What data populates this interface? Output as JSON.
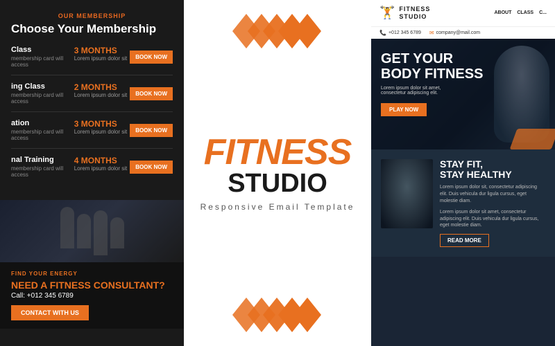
{
  "left": {
    "membership": {
      "our_membership": "OUR MEMBERSHIP",
      "title": "Choose Your Membership",
      "items": [
        {
          "name": "Class",
          "desc": "membership card will access",
          "duration": "3 MONTHS",
          "duration_desc": "Lorem ipsum dolor sit",
          "button": "BOOK NOW"
        },
        {
          "name": "ing Class",
          "desc": "membership card will access",
          "duration": "2 MONTHS",
          "duration_desc": "Lorem ipsum dolor sit",
          "button": "BOOK NOW"
        },
        {
          "name": "ation",
          "desc": "membership card will access",
          "duration": "3 MONTHS",
          "duration_desc": "Lorem ipsum dolor sit",
          "button": "BOOK NOW"
        },
        {
          "name": "nal Training",
          "desc": "membership card will access",
          "duration": "4 MONTHS",
          "duration_desc": "Lorem ipsum dolor sit",
          "button": "BOOK NOW"
        }
      ]
    },
    "consultant": {
      "find_energy": "FIND YOUR ENERGY",
      "title_pre": "EED A FITNESS CONSULTANT?",
      "call_label": "Call:",
      "phone": "+012 345 6789",
      "button": "CONTACT WITH US"
    }
  },
  "middle": {
    "fitness": "FITNESS",
    "studio": "STUDIO",
    "tagline": "Responsive Email Template"
  },
  "right": {
    "logo": {
      "icon": "🏋",
      "line1": "FITNESS",
      "line2": "STUDIO"
    },
    "nav": [
      "ABOUT",
      "CLASS",
      "C..."
    ],
    "contacts": [
      {
        "icon": "📞",
        "text": "+012 345 6789"
      },
      {
        "icon": "✉",
        "text": "company@mail.com"
      }
    ],
    "hero": {
      "title": "GET YOUR\nBODY FITNESS",
      "subtitle": "Lorem ipsum dolor sit amet,\nconsectetur adipiscing elit.",
      "button": "PLAY NOW"
    },
    "stay_fit": {
      "title": "STAY FIT,\nSTAY HEALTHY",
      "text1": "Lorem ipsum dolor sit, consectetur\nadipiscing elit. Duis vehicula dur\nligula cursus, eget molestie diam.",
      "text2": "Lorem ipsum dolor sit amet, consectetur\nadipiscing elit. Duis vehicula dur\nligula cursus, eget molestie diam.",
      "button": "READ MORE"
    }
  },
  "colors": {
    "accent": "#e87020",
    "dark_bg": "#1a1a1a",
    "dark_blue": "#1a2535"
  }
}
